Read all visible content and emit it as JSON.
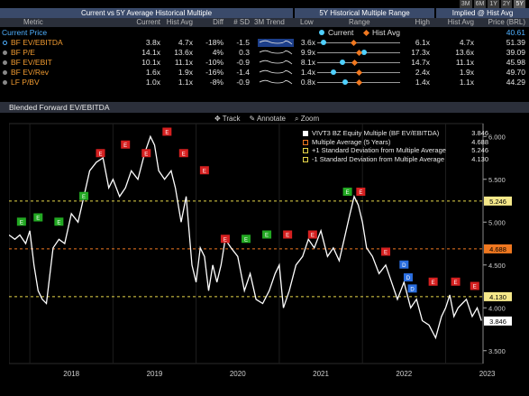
{
  "range_buttons": [
    "3M",
    "6M",
    "1Y",
    "2Y",
    "5Y"
  ],
  "active_range": "5Y",
  "table": {
    "group_headers": {
      "current_vs_avg": "Current vs 5Y Average Historical Multiple",
      "hist_range": "5Y Historical Multiple Range",
      "implied": "Implied @ Hist Avg"
    },
    "columns": {
      "metric": "Metric",
      "current": "Current",
      "hist_avg": "Hist Avg",
      "diff": "Diff",
      "sd": "# SD",
      "trend": "3M Trend",
      "low": "Low",
      "range": "Range",
      "high": "High",
      "implied_hist_avg": "Hist Avg",
      "price": "Price (BRL)"
    },
    "legend_current": "Current",
    "legend_hist_avg": "Hist Avg",
    "current_price_label": "Current Price",
    "current_price_value": "40.61",
    "rows": [
      {
        "metric": "BF EV/EBITDA",
        "current": "3.8x",
        "hist_avg": "4.7x",
        "diff": "-18%",
        "sd": "-1.5",
        "low": "3.6x",
        "high": "6.1x",
        "implied": "4.7x",
        "price": "51.39",
        "selected": true
      },
      {
        "metric": "BF P/E",
        "current": "14.1x",
        "hist_avg": "13.6x",
        "diff": "4%",
        "sd": "0.3",
        "low": "9.9x",
        "high": "17.3x",
        "implied": "13.6x",
        "price": "39.09",
        "selected": false
      },
      {
        "metric": "BF EV/EBIT",
        "current": "10.1x",
        "hist_avg": "11.1x",
        "diff": "-10%",
        "sd": "-0.9",
        "low": "8.1x",
        "high": "14.7x",
        "implied": "11.1x",
        "price": "45.98",
        "selected": false
      },
      {
        "metric": "BF EV/Rev",
        "current": "1.6x",
        "hist_avg": "1.9x",
        "diff": "-16%",
        "sd": "-1.4",
        "low": "1.4x",
        "high": "2.4x",
        "implied": "1.9x",
        "price": "49.70",
        "selected": false
      },
      {
        "metric": "LF P/BV",
        "current": "1.0x",
        "hist_avg": "1.1x",
        "diff": "-8%",
        "sd": "-0.9",
        "low": "0.8x",
        "high": "1.4x",
        "implied": "1.1x",
        "price": "44.29",
        "selected": false
      }
    ]
  },
  "chart_title": "Blended Forward EV/EBITDA",
  "toolbar": {
    "track": "Track",
    "annotate": "Annotate",
    "zoom": "Zoom"
  },
  "colors": {
    "line": "#ffffff",
    "avg": "#f07820",
    "sd": "#e8d84a",
    "earn_green": "#22a822",
    "earn_red": "#d62020",
    "earn_blue": "#2a6ee0"
  },
  "chart_data": {
    "type": "line",
    "title": "Blended Forward EV/EBITDA",
    "xlabel": "",
    "ylabel": "",
    "x_ticks": [
      "2018",
      "2019",
      "2020",
      "2021",
      "2022",
      "2023"
    ],
    "y_ticks": [
      "3.500",
      "4.000",
      "4.500",
      "5.000",
      "5.500",
      "6.000"
    ],
    "ylim": [
      3.35,
      6.15
    ],
    "xlim": [
      2017.75,
      2023.45
    ],
    "legend": [
      {
        "label": "VIVT3 BZ Equity Multiple (BF EV/EBITDA)",
        "value": "3.846",
        "color": "#ffffff"
      },
      {
        "label": "Multiple Average (5 Years)",
        "value": "4.688",
        "color": "#f07820"
      },
      {
        "label": "+1 Standard Deviation from Multiple Average",
        "value": "5.246",
        "color": "#e8d84a"
      },
      {
        "label": "-1 Standard Deviation from Multiple Average",
        "value": "4.130",
        "color": "#e8d84a"
      }
    ],
    "reference_lines": {
      "average": 4.688,
      "plus_1sd": 5.246,
      "minus_1sd": 4.13
    },
    "value_tags": [
      "5.246",
      "4.688",
      "4.130",
      "3.846"
    ],
    "series": [
      {
        "name": "VIVT3 BZ Equity Multiple (BF EV/EBITDA)",
        "x": [
          2017.75,
          2017.82,
          2017.88,
          2017.95,
          2018.0,
          2018.05,
          2018.1,
          2018.15,
          2018.2,
          2018.28,
          2018.35,
          2018.42,
          2018.5,
          2018.58,
          2018.65,
          2018.72,
          2018.8,
          2018.88,
          2018.95,
          2019.0,
          2019.08,
          2019.15,
          2019.22,
          2019.3,
          2019.38,
          2019.45,
          2019.5,
          2019.55,
          2019.62,
          2019.7,
          2019.75,
          2019.82,
          2019.88,
          2019.95,
          2020.0,
          2020.05,
          2020.1,
          2020.15,
          2020.2,
          2020.25,
          2020.3,
          2020.35,
          2020.42,
          2020.5,
          2020.58,
          2020.65,
          2020.72,
          2020.8,
          2020.88,
          2020.95,
          2021.0,
          2021.05,
          2021.12,
          2021.2,
          2021.28,
          2021.35,
          2021.42,
          2021.5,
          2021.58,
          2021.65,
          2021.72,
          2021.78,
          2021.85,
          2021.9,
          2021.95,
          2022.0,
          2022.05,
          2022.12,
          2022.2,
          2022.28,
          2022.35,
          2022.42,
          2022.5,
          2022.58,
          2022.65,
          2022.72,
          2022.8,
          2022.88,
          2022.95,
          2023.0,
          2023.05,
          2023.1,
          2023.15,
          2023.2,
          2023.25,
          2023.32,
          2023.38,
          2023.43
        ],
        "values": [
          4.85,
          4.8,
          4.85,
          4.75,
          4.9,
          4.5,
          4.2,
          4.1,
          4.05,
          4.7,
          4.8,
          4.75,
          5.1,
          5.0,
          5.3,
          5.6,
          5.7,
          5.75,
          5.4,
          5.5,
          5.3,
          5.4,
          5.6,
          5.5,
          5.8,
          6.0,
          5.9,
          5.6,
          5.5,
          5.6,
          5.4,
          5.0,
          5.3,
          4.5,
          4.3,
          4.7,
          4.6,
          4.2,
          4.5,
          4.3,
          4.5,
          4.8,
          4.7,
          4.6,
          4.2,
          4.4,
          4.1,
          4.05,
          4.2,
          4.4,
          4.5,
          4.0,
          4.2,
          4.5,
          4.6,
          4.8,
          4.7,
          4.9,
          4.6,
          4.7,
          4.55,
          4.8,
          5.1,
          5.3,
          5.2,
          5.0,
          4.7,
          4.6,
          4.4,
          4.5,
          4.3,
          4.1,
          4.3,
          4.0,
          4.1,
          3.85,
          3.8,
          3.65,
          3.9,
          4.0,
          4.15,
          3.9,
          4.0,
          4.05,
          4.1,
          3.9,
          4.0,
          3.85
        ]
      }
    ],
    "earnings_markers": [
      {
        "x": 2017.9,
        "y": 5.0,
        "type": "E",
        "color": "green"
      },
      {
        "x": 2018.1,
        "y": 5.05,
        "type": "E",
        "color": "green"
      },
      {
        "x": 2018.35,
        "y": 5.0,
        "type": "E",
        "color": "green"
      },
      {
        "x": 2018.65,
        "y": 5.3,
        "type": "E",
        "color": "green"
      },
      {
        "x": 2018.85,
        "y": 5.8,
        "type": "E",
        "color": "red"
      },
      {
        "x": 2019.15,
        "y": 5.9,
        "type": "E",
        "color": "red"
      },
      {
        "x": 2019.4,
        "y": 5.8,
        "type": "E",
        "color": "red"
      },
      {
        "x": 2019.65,
        "y": 6.05,
        "type": "E",
        "color": "red"
      },
      {
        "x": 2019.85,
        "y": 5.8,
        "type": "E",
        "color": "red"
      },
      {
        "x": 2020.1,
        "y": 5.6,
        "type": "E",
        "color": "red"
      },
      {
        "x": 2020.35,
        "y": 4.8,
        "type": "E",
        "color": "red"
      },
      {
        "x": 2020.6,
        "y": 4.8,
        "type": "E",
        "color": "green"
      },
      {
        "x": 2020.85,
        "y": 4.85,
        "type": "E",
        "color": "green"
      },
      {
        "x": 2021.1,
        "y": 4.85,
        "type": "E",
        "color": "red"
      },
      {
        "x": 2021.4,
        "y": 4.85,
        "type": "E",
        "color": "red"
      },
      {
        "x": 2021.82,
        "y": 5.35,
        "type": "E",
        "color": "green"
      },
      {
        "x": 2021.98,
        "y": 5.35,
        "type": "E",
        "color": "red"
      },
      {
        "x": 2022.28,
        "y": 4.65,
        "type": "E",
        "color": "red"
      },
      {
        "x": 2022.5,
        "y": 4.5,
        "type": "D",
        "color": "blue"
      },
      {
        "x": 2022.55,
        "y": 4.35,
        "type": "D",
        "color": "blue"
      },
      {
        "x": 2022.6,
        "y": 4.22,
        "type": "D",
        "color": "blue"
      },
      {
        "x": 2022.85,
        "y": 4.3,
        "type": "E",
        "color": "red"
      },
      {
        "x": 2023.12,
        "y": 4.3,
        "type": "E",
        "color": "red"
      },
      {
        "x": 2023.35,
        "y": 4.25,
        "type": "E",
        "color": "red"
      }
    ]
  }
}
